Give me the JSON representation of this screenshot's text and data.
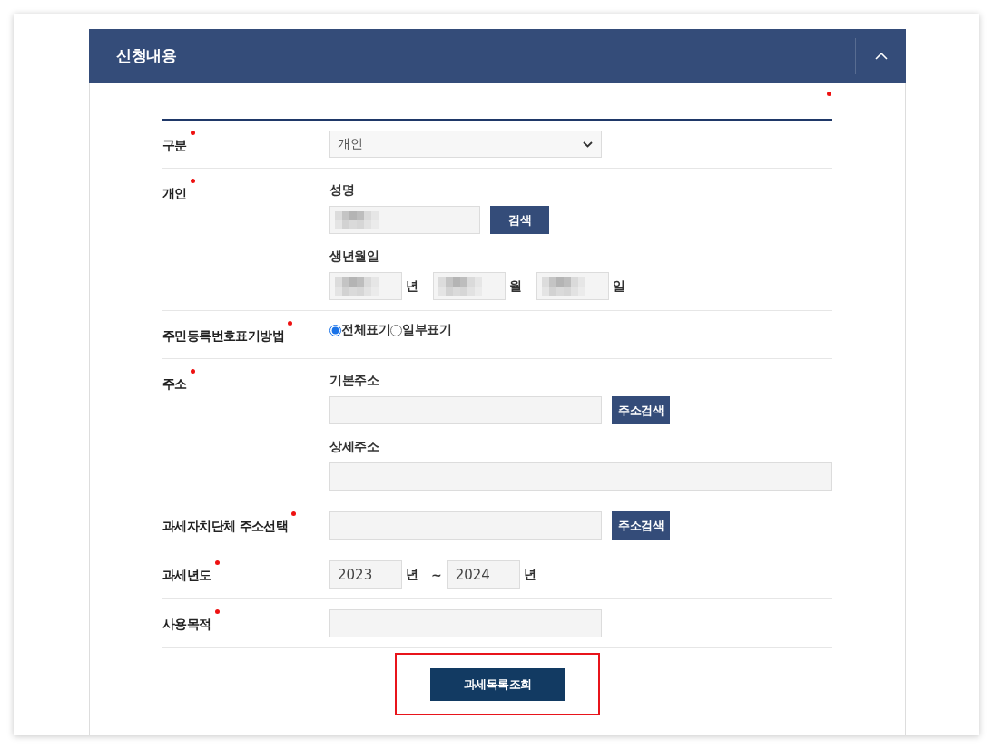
{
  "panel": {
    "title": "신청내용",
    "expanded": true
  },
  "required_legend": {
    "marker": true
  },
  "form": {
    "rows": [
      {
        "kind": "select",
        "label": "구분",
        "required": true,
        "value": "개인"
      },
      {
        "kind": "person",
        "label": "개인",
        "required": true,
        "name": {
          "label": "성명",
          "redacted": true,
          "button": "검색"
        },
        "birth": {
          "label": "생년월일",
          "parts": [
            {
              "redacted": true,
              "unit": "년"
            },
            {
              "redacted": true,
              "unit": "월"
            },
            {
              "redacted": true,
              "unit": "일"
            }
          ]
        }
      },
      {
        "kind": "radio",
        "label": "주민등록번호표기방법",
        "required": true,
        "options": [
          {
            "label": "전체표기",
            "selected": true
          },
          {
            "label": "일부표기",
            "selected": false
          }
        ]
      },
      {
        "kind": "address",
        "label": "주소",
        "required": true,
        "basic": {
          "label": "기본주소",
          "button": "주소검색"
        },
        "detail": {
          "label": "상세주소"
        }
      },
      {
        "kind": "search",
        "label": "과세자치단체 주소선택",
        "required": true,
        "button": "주소검색"
      },
      {
        "kind": "range",
        "label": "과세년도",
        "required": true,
        "from": {
          "value": "2023",
          "unit": "년"
        },
        "separator": "~",
        "to": {
          "value": "2024",
          "unit": "년"
        }
      },
      {
        "kind": "text",
        "label": "사용목적",
        "required": true
      }
    ],
    "submit": {
      "label": "과세목록조회",
      "highlighted": true
    }
  }
}
